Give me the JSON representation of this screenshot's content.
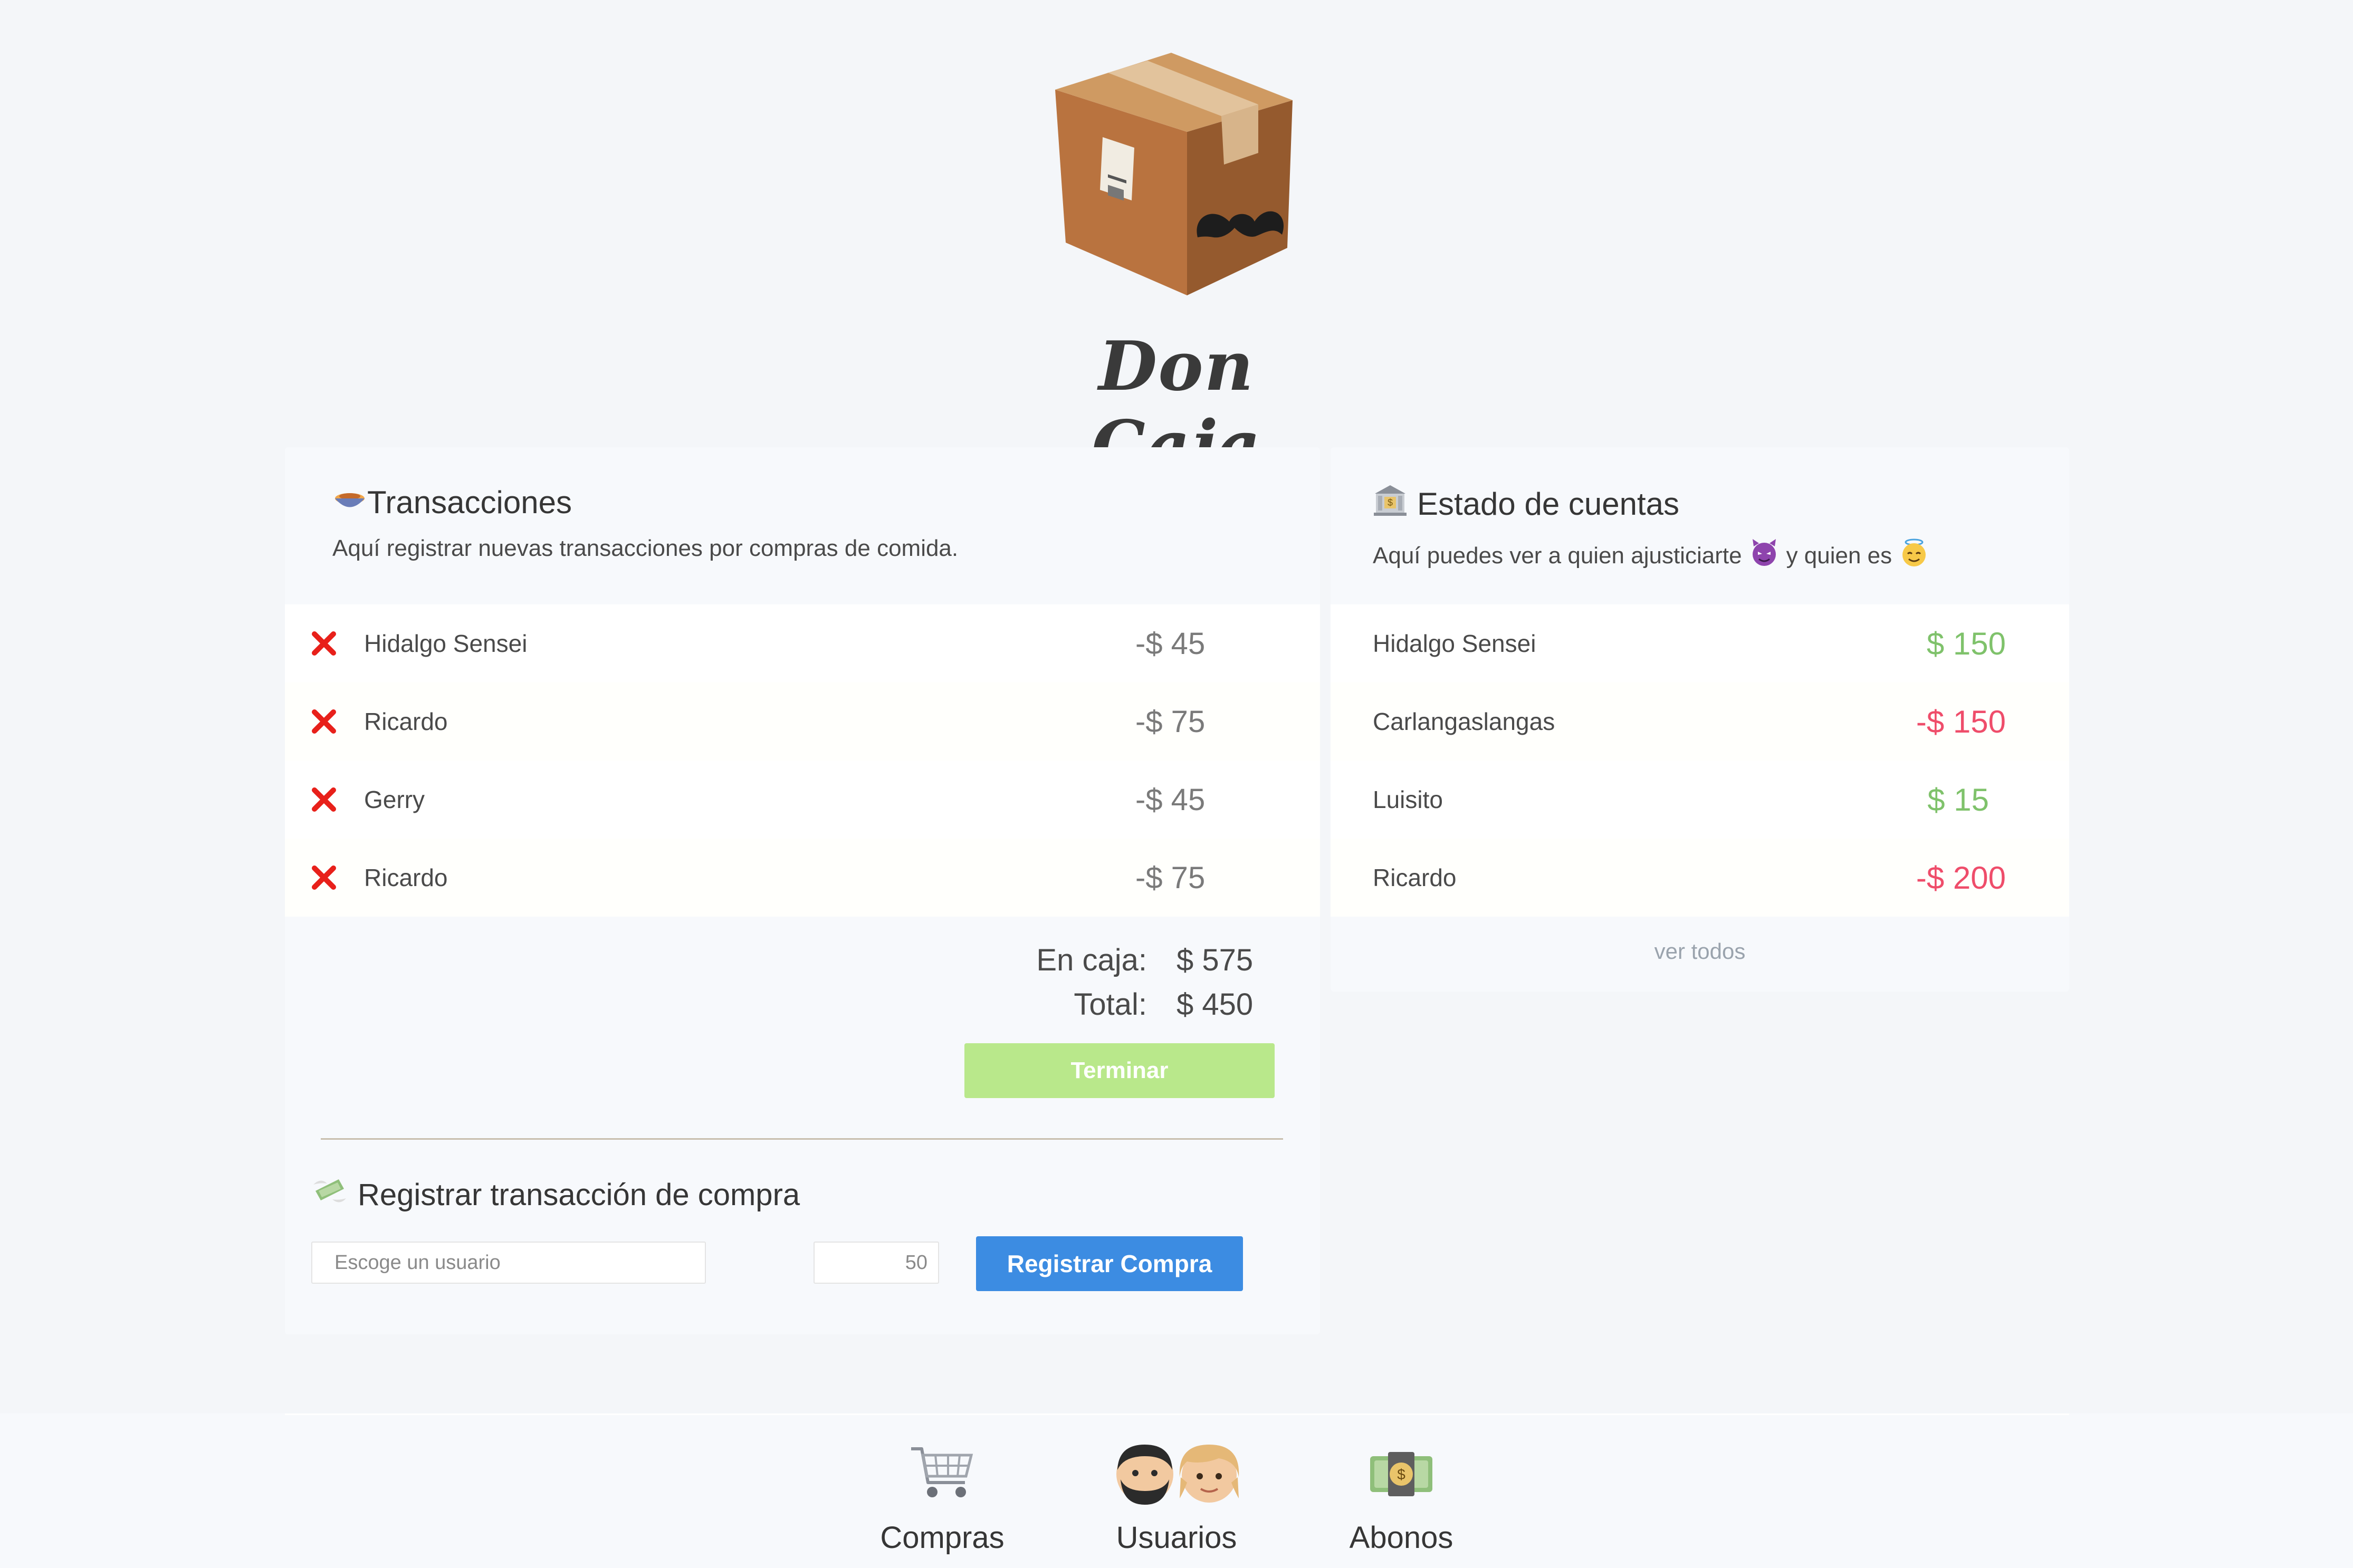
{
  "app": {
    "logo_text": "Don Caja",
    "logo_icon": "package-mustache-icon"
  },
  "transactions": {
    "title": "Transacciones",
    "title_icon": "food-bowl-icon",
    "subtitle": "Aquí registrar nuevas transacciones por compras de comida.",
    "items": [
      {
        "name": "Hidalgo Sensei",
        "amount": "-$ 45"
      },
      {
        "name": "Ricardo",
        "amount": "-$ 75"
      },
      {
        "name": "Gerry",
        "amount": "-$ 45"
      },
      {
        "name": "Ricardo",
        "amount": "-$ 75"
      }
    ],
    "en_caja_label": "En caja:",
    "en_caja_value": "$ 575",
    "total_label": "Total:",
    "total_value": "$ 450",
    "finish_button": "Terminar"
  },
  "register": {
    "title": "Registrar transacción de compra",
    "title_icon": "money-wings-icon",
    "user_placeholder": "Escoge un usuario",
    "amount_placeholder": "50",
    "submit_button": "Registrar Compra"
  },
  "accounts": {
    "title": "Estado de cuentas",
    "title_icon": "bank-icon",
    "subtitle_part1": "Aquí puedes ver a quien ajusticiarte",
    "subtitle_part2": "y quien es",
    "devil_icon": "devil-face-icon",
    "angel_icon": "angel-face-icon",
    "items": [
      {
        "name": "Hidalgo Sensei",
        "amount": "$ 150",
        "status": "positive"
      },
      {
        "name": "Carlangaslangas",
        "amount": "-$ 150",
        "status": "negative"
      },
      {
        "name": "Luisito",
        "amount": "$ 15",
        "status": "positive"
      },
      {
        "name": "Ricardo",
        "amount": "-$ 200",
        "status": "negative"
      }
    ],
    "view_all": "ver todos"
  },
  "nav": [
    {
      "label": "Compras",
      "icon": "shopping-cart-icon"
    },
    {
      "label": "Usuarios",
      "icon": "users-icon"
    },
    {
      "label": "Abonos",
      "icon": "money-bag-icon"
    }
  ],
  "colors": {
    "positive": "#7fc26b",
    "negative": "#ef4d6a",
    "primary_button": "#3c8ce2",
    "finish_button": "#b9e88b",
    "delete_icon": "#e8201a"
  }
}
